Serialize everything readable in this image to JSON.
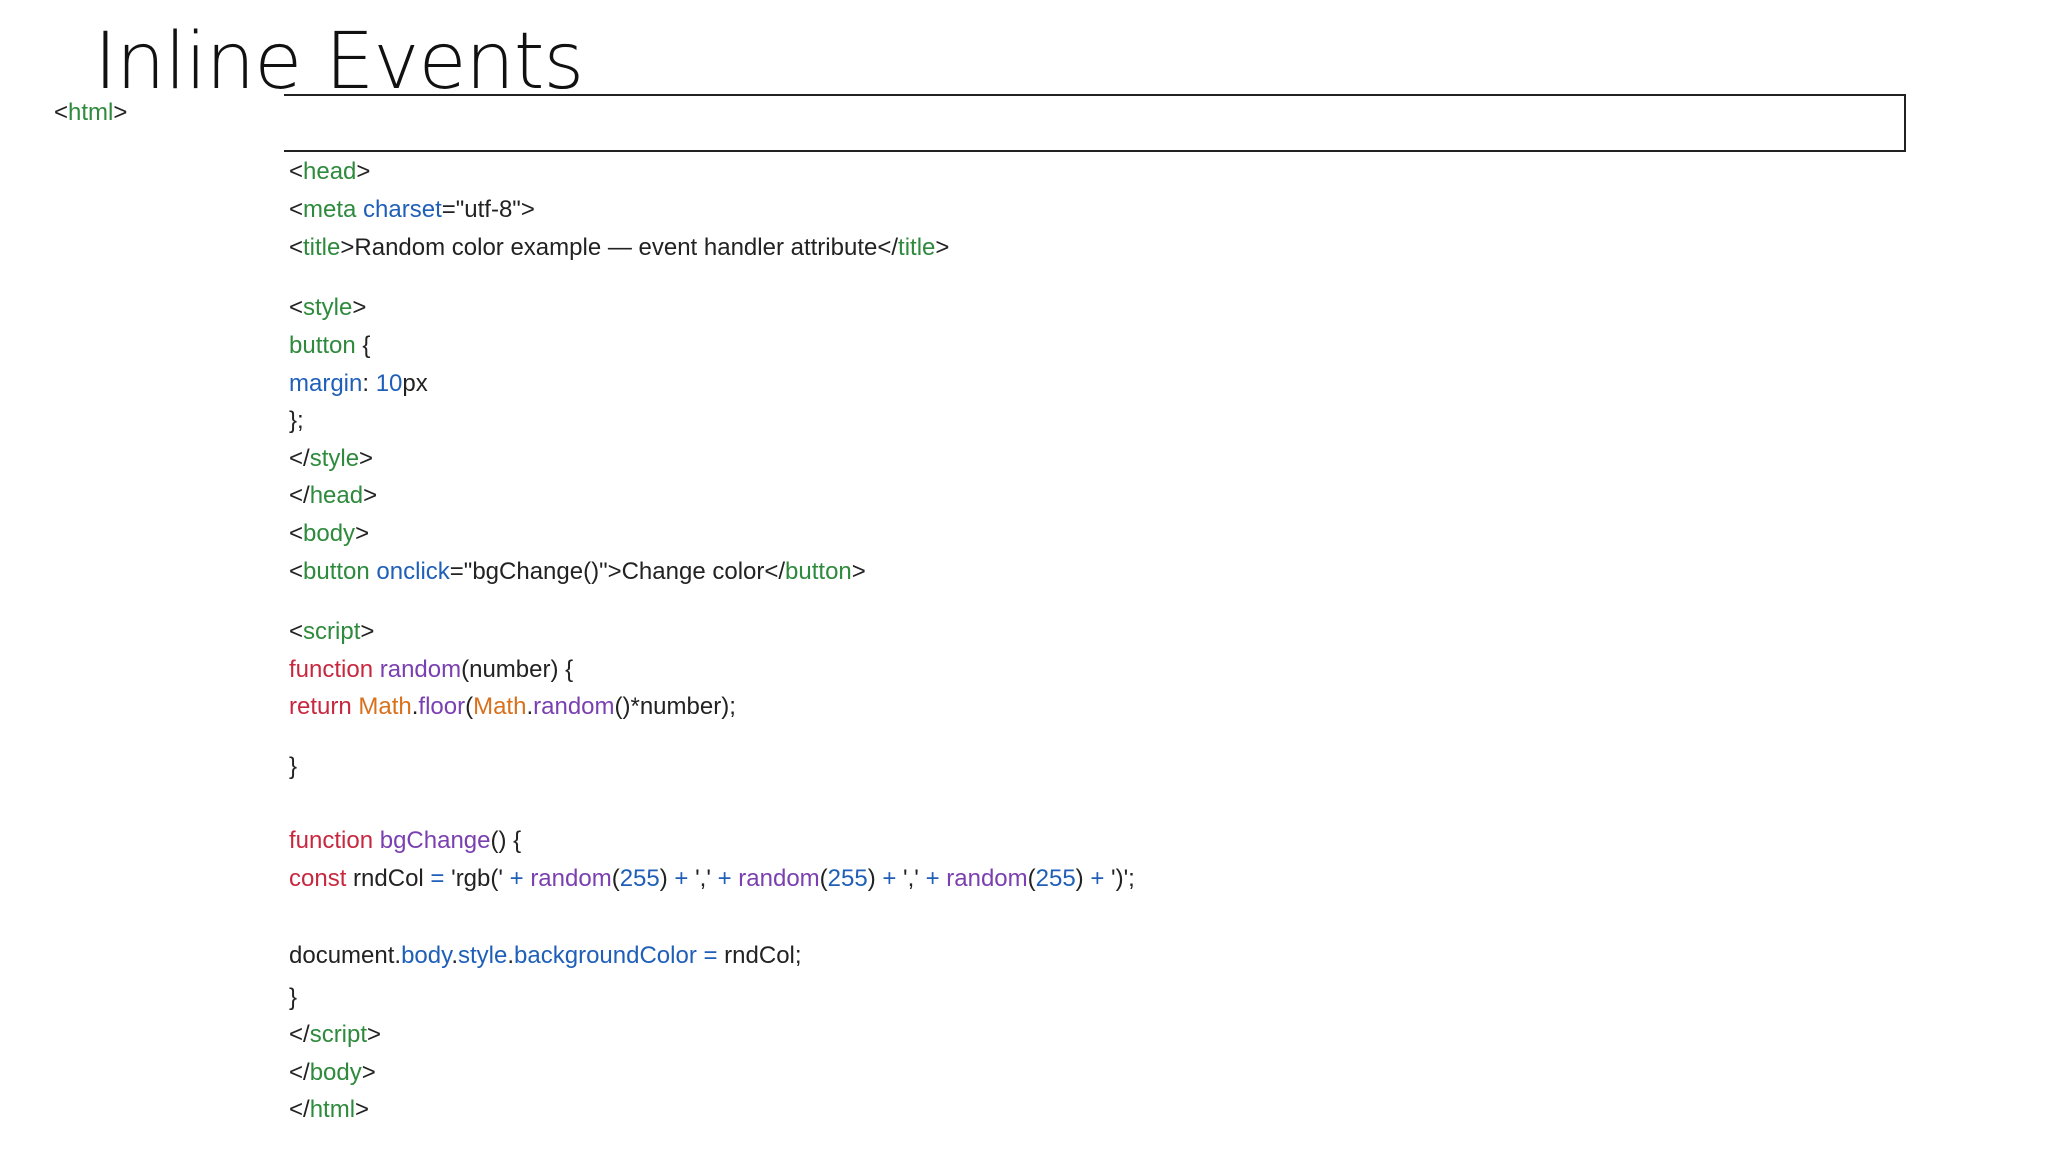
{
  "slide": {
    "title": "Inline Events",
    "html_open": {
      "open": "<",
      "tag": "html",
      "close": ">"
    }
  },
  "colors": {
    "text": "#222222",
    "tag": "#2e8a3c",
    "attribute": "#1f5fb8",
    "keyword": "#c8283f",
    "function": "#7a3fb0",
    "object": "#d8701c"
  },
  "code_lines": [
    [
      [
        "dk",
        "<"
      ],
      [
        "gr",
        "head"
      ],
      [
        "dk",
        ">"
      ]
    ],
    [
      [
        "dk",
        "<"
      ],
      [
        "gr",
        "meta"
      ],
      [
        "dk",
        " "
      ],
      [
        "bl",
        "charset"
      ],
      [
        "dk",
        "=\"utf-8\">"
      ]
    ],
    [
      [
        "dk",
        "<"
      ],
      [
        "gr",
        "title"
      ],
      [
        "dk",
        ">Random color example — event handler attribute</"
      ],
      [
        "gr",
        "title"
      ],
      [
        "dk",
        ">"
      ]
    ],
    [
      [
        "dk",
        "<"
      ],
      [
        "gr",
        "style"
      ],
      [
        "dk",
        ">"
      ]
    ],
    [
      [
        "gr",
        "button"
      ],
      [
        "dk",
        " {"
      ]
    ],
    [
      [
        "bl",
        "margin"
      ],
      [
        "dk",
        ": "
      ],
      [
        "bl",
        "10"
      ],
      [
        "dk",
        "px"
      ]
    ],
    [
      [
        "dk",
        "};"
      ]
    ],
    [
      [
        "dk",
        "</"
      ],
      [
        "gr",
        "style"
      ],
      [
        "dk",
        ">"
      ]
    ],
    [
      [
        "dk",
        "</"
      ],
      [
        "gr",
        "head"
      ],
      [
        "dk",
        ">"
      ]
    ],
    [
      [
        "dk",
        "<"
      ],
      [
        "gr",
        "body"
      ],
      [
        "dk",
        ">"
      ]
    ],
    [
      [
        "dk",
        "<"
      ],
      [
        "gr",
        "button"
      ],
      [
        "dk",
        " "
      ],
      [
        "bl",
        "onclick"
      ],
      [
        "dk",
        "=\"bgChange()\">Change color</"
      ],
      [
        "gr",
        "button"
      ],
      [
        "dk",
        ">"
      ]
    ],
    [
      [
        "dk",
        "<"
      ],
      [
        "gr",
        "script"
      ],
      [
        "dk",
        ">"
      ]
    ],
    [
      [
        "rd",
        "function"
      ],
      [
        "dk",
        " "
      ],
      [
        "pu",
        "random"
      ],
      [
        "dk",
        "(number) {"
      ]
    ],
    [
      [
        "rd",
        "return"
      ],
      [
        "dk",
        " "
      ],
      [
        "or",
        "Math"
      ],
      [
        "dk",
        "."
      ],
      [
        "pu",
        "floor"
      ],
      [
        "dk",
        "("
      ],
      [
        "or",
        "Math"
      ],
      [
        "dk",
        "."
      ],
      [
        "pu",
        "random"
      ],
      [
        "dk",
        "()*number);"
      ]
    ],
    [
      [
        "dk",
        "}"
      ]
    ],
    [
      [
        "rd",
        "function"
      ],
      [
        "dk",
        " "
      ],
      [
        "pu",
        "bgChange"
      ],
      [
        "dk",
        "() {"
      ]
    ],
    [
      [
        "rd",
        "const"
      ],
      [
        "dk",
        " rndCol "
      ],
      [
        "bl",
        "="
      ],
      [
        "dk",
        " 'rgb(' "
      ],
      [
        "bl",
        "+"
      ],
      [
        "dk",
        " "
      ],
      [
        "pu",
        "random"
      ],
      [
        "dk",
        "("
      ],
      [
        "bl",
        "255"
      ],
      [
        "dk",
        ") "
      ],
      [
        "bl",
        "+"
      ],
      [
        "dk",
        " ',' "
      ],
      [
        "bl",
        "+"
      ],
      [
        "dk",
        " "
      ],
      [
        "pu",
        "random"
      ],
      [
        "dk",
        "("
      ],
      [
        "bl",
        "255"
      ],
      [
        "dk",
        ") "
      ],
      [
        "bl",
        "+"
      ],
      [
        "dk",
        " ',' "
      ],
      [
        "bl",
        "+"
      ],
      [
        "dk",
        " "
      ],
      [
        "pu",
        "random"
      ],
      [
        "dk",
        "("
      ],
      [
        "bl",
        "255"
      ],
      [
        "dk",
        ") "
      ],
      [
        "bl",
        "+"
      ],
      [
        "dk",
        " ')';"
      ]
    ],
    [
      [
        "dk",
        "document."
      ],
      [
        "bl",
        "body"
      ],
      [
        "dk",
        "."
      ],
      [
        "bl",
        "style"
      ],
      [
        "dk",
        "."
      ],
      [
        "bl",
        "backgroundColor"
      ],
      [
        "dk",
        " "
      ],
      [
        "bl",
        "="
      ],
      [
        "dk",
        " rndCol;"
      ]
    ],
    [
      [
        "dk",
        "}"
      ]
    ],
    [
      [
        "dk",
        "</"
      ],
      [
        "gr",
        "script"
      ],
      [
        "dk",
        ">"
      ]
    ],
    [
      [
        "dk",
        "</"
      ],
      [
        "gr",
        "body"
      ],
      [
        "dk",
        ">"
      ]
    ],
    [
      [
        "dk",
        "</"
      ],
      [
        "gr",
        "html"
      ],
      [
        "dk",
        ">"
      ]
    ]
  ]
}
